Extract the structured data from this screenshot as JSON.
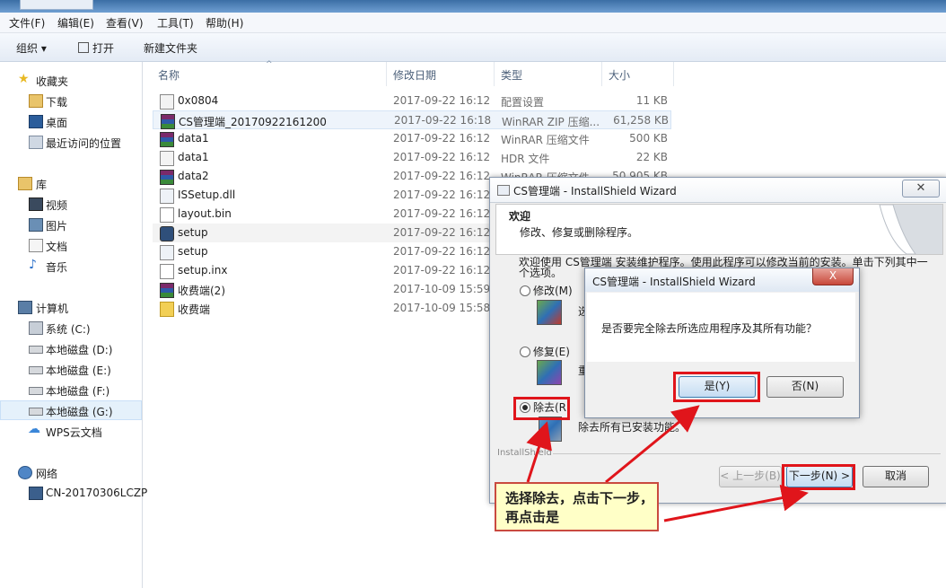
{
  "menubar": {
    "items": [
      "文件(F)",
      "编辑(E)",
      "查看(V)",
      "工具(T)",
      "帮助(H)"
    ]
  },
  "toolbar": {
    "organize": "组织",
    "open": "打开",
    "new_folder": "新建文件夹"
  },
  "nav": {
    "favorites": "收藏夹",
    "downloads": "下载",
    "desktop": "桌面",
    "recent": "最近访问的位置",
    "libraries": "库",
    "videos": "视频",
    "pictures": "图片",
    "documents": "文档",
    "music": "音乐",
    "computer": "计算机",
    "drive_c": "系统 (C:)",
    "drive_d": "本地磁盘 (D:)",
    "drive_e": "本地磁盘 (E:)",
    "drive_f": "本地磁盘 (F:)",
    "drive_g": "本地磁盘 (G:)",
    "wps": "WPS云文档",
    "network": "网络",
    "pc": "CN-20170306LCZP"
  },
  "columns": {
    "name": "名称",
    "date": "修改日期",
    "type": "类型",
    "size": "大小"
  },
  "files": [
    {
      "name": "0x0804",
      "date": "2017-09-22 16:12",
      "type": "配置设置",
      "size": "11 KB"
    },
    {
      "name": "CS管理端_20170922161200",
      "date": "2017-09-22 16:18",
      "type": "WinRAR ZIP 压缩...",
      "size": "61,258 KB"
    },
    {
      "name": "data1",
      "date": "2017-09-22 16:12",
      "type": "WinRAR 压缩文件",
      "size": "500 KB"
    },
    {
      "name": "data1",
      "date": "2017-09-22 16:12",
      "type": "HDR 文件",
      "size": "22 KB"
    },
    {
      "name": "data2",
      "date": "2017-09-22 16:12",
      "type": "WinRAR 压缩文件",
      "size": "50,905 KB"
    },
    {
      "name": "ISSetup.dll",
      "date": "2017-09-22 16:12",
      "type": "",
      "size": ""
    },
    {
      "name": "layout.bin",
      "date": "2017-09-22 16:12",
      "type": "",
      "size": ""
    },
    {
      "name": "setup",
      "date": "2017-09-22 16:12",
      "type": "",
      "size": ""
    },
    {
      "name": "setup",
      "date": "2017-09-22 16:12",
      "type": "",
      "size": ""
    },
    {
      "name": "setup.inx",
      "date": "2017-09-22 16:12",
      "type": "",
      "size": ""
    },
    {
      "name": "收费端(2)",
      "date": "2017-10-09 15:59",
      "type": "",
      "size": ""
    },
    {
      "name": "收费端",
      "date": "2017-10-09 15:58",
      "type": "",
      "size": ""
    }
  ],
  "wizard": {
    "title": "CS管理端 - InstallShield Wizard",
    "heading": "欢迎",
    "subheading": "修改、修复或删除程序。",
    "intro": "欢迎使用 CS管理端 安装维护程序。使用此程序可以修改当前的安装。单击下列其中一个选项。",
    "opt_modify": "修改(M)",
    "opt_modify_desc": "选",
    "opt_repair": "修复(E)",
    "opt_repair_desc": "重",
    "opt_remove": "除去(R)",
    "opt_remove_desc": "除去所有已安装功能。",
    "brand": "InstallShield",
    "back": "< 上一步(B)",
    "next": "下一步(N) >",
    "cancel": "取消"
  },
  "confirm": {
    "title": "CS管理端 - InstallShield Wizard",
    "close": "X",
    "message": "是否要完全除去所选应用程序及其所有功能？",
    "yes": "是(Y)",
    "no": "否(N)"
  },
  "callout": {
    "text": "选择除去，点击下一步，再点击是"
  },
  "colors": {
    "annotation_red": "#e0151b",
    "callout_bg": "#ffffc7"
  }
}
